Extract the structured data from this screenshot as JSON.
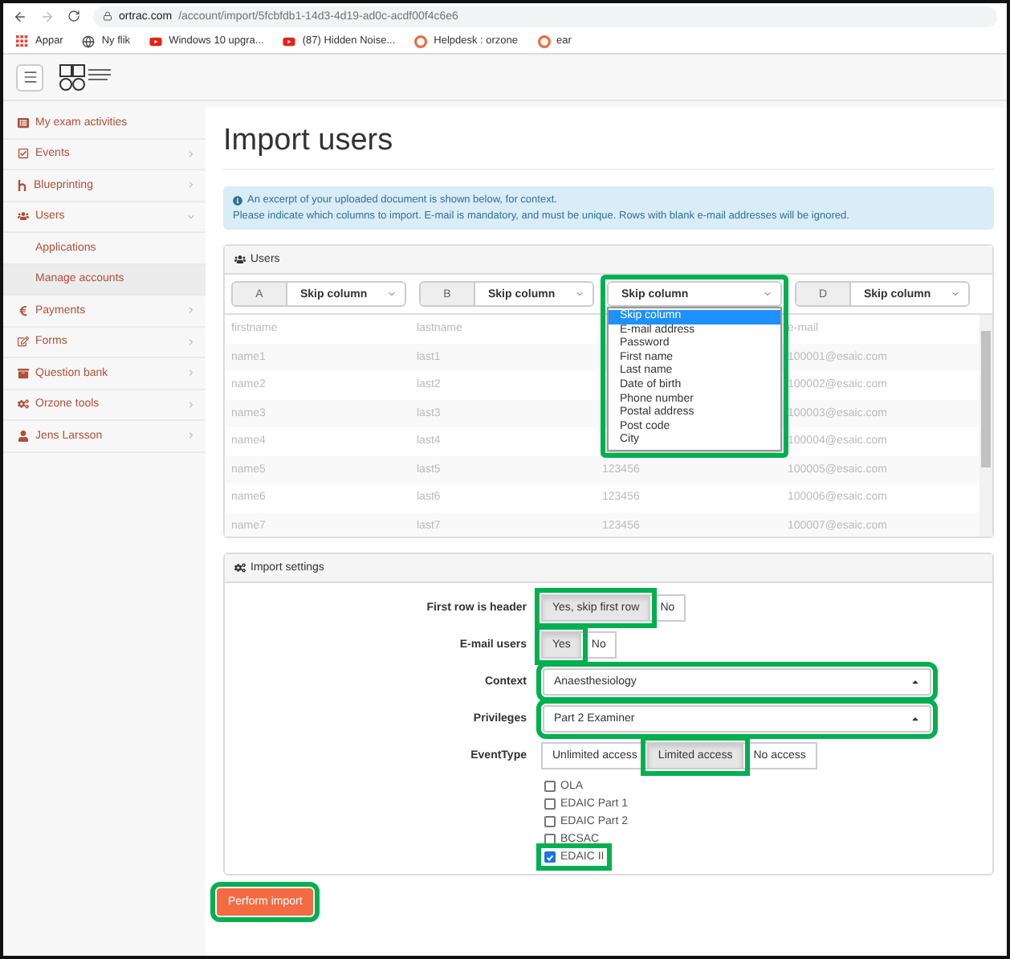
{
  "browser": {
    "host": "ortrac.com",
    "path": "/account/import/5fcbfdb1-14d3-4d19-ad0c-acdf00f4c6e6",
    "bookmarks": [
      {
        "label": "Appar",
        "kind": "apps"
      },
      {
        "label": "Ny flik",
        "kind": "globe"
      },
      {
        "label": "Windows 10 upgra...",
        "kind": "video"
      },
      {
        "label": "(87) Hidden Noise...",
        "kind": "video"
      },
      {
        "label": "Helpdesk : orzone",
        "kind": "help"
      },
      {
        "label": "ear",
        "kind": "help"
      }
    ]
  },
  "sidebar": {
    "items": [
      {
        "label": "My exam activities",
        "kind": "link"
      },
      {
        "label": "Events",
        "kind": "group",
        "expanded": false
      },
      {
        "label": "Blueprinting",
        "kind": "group",
        "expanded": false
      },
      {
        "label": "Users",
        "kind": "group",
        "expanded": true,
        "children": [
          {
            "label": "Applications",
            "selected": false
          },
          {
            "label": "Manage accounts",
            "selected": true
          }
        ]
      },
      {
        "label": "Payments",
        "kind": "group",
        "expanded": false
      },
      {
        "label": "Forms",
        "kind": "group",
        "expanded": false
      },
      {
        "label": "Question bank",
        "kind": "group",
        "expanded": false
      },
      {
        "label": "Orzone tools",
        "kind": "group",
        "expanded": false
      },
      {
        "label": "Jens Larsson",
        "kind": "group",
        "expanded": false
      }
    ]
  },
  "page": {
    "title": "Import users",
    "info": [
      "An excerpt of your uploaded document is shown below, for context.",
      "Please indicate which columns to import. E-mail is mandatory, and must be unique. Rows with blank e-mail addresses will be ignored."
    ]
  },
  "users_panel": {
    "title": "Users",
    "columns": [
      {
        "letter": "A",
        "value": "Skip column",
        "open": false,
        "highlighted": false
      },
      {
        "letter": "B",
        "value": "Skip column",
        "open": false,
        "highlighted": false
      },
      {
        "value": "Skip column",
        "open": true,
        "highlighted": true,
        "options": [
          {
            "label": "Skip column",
            "selected": true
          },
          {
            "label": "E-mail address",
            "selected": false
          },
          {
            "label": "Password",
            "selected": false
          },
          {
            "label": "First name",
            "selected": false
          },
          {
            "label": "Last name",
            "selected": false
          },
          {
            "label": "Date of birth",
            "selected": false
          },
          {
            "label": "Phone number",
            "selected": false
          },
          {
            "label": "Postal address",
            "selected": false
          },
          {
            "label": "Post code",
            "selected": false
          },
          {
            "label": "City",
            "selected": false
          }
        ]
      },
      {
        "letter": "D",
        "value": "Skip column",
        "open": false,
        "highlighted": false
      }
    ],
    "rows": [
      {
        "a": "firstname",
        "b": "lastname",
        "d": "e-mail"
      },
      {
        "a": "name1",
        "b": "last1",
        "d": "100001@esaic.com"
      },
      {
        "a": "name2",
        "b": "last2",
        "d": "100002@esaic.com"
      },
      {
        "a": "name3",
        "b": "last3",
        "d": "100003@esaic.com"
      },
      {
        "a": "name4",
        "b": "last4",
        "d": "100004@esaic.com"
      },
      {
        "a": "name5",
        "b": "last5",
        "c": "123456",
        "d": "100005@esaic.com"
      },
      {
        "a": "name6",
        "b": "last6",
        "c": "123456",
        "d": "100006@esaic.com"
      },
      {
        "a": "name7",
        "b": "last7",
        "c": "123456",
        "d": "100007@esaic.com"
      }
    ]
  },
  "settings_panel": {
    "title": "Import settings",
    "fields": [
      {
        "kind": "toggle",
        "label": "First row is header",
        "options": [
          {
            "label": "Yes, skip first row",
            "selected": true,
            "highlighted": true
          },
          {
            "label": "No",
            "selected": false,
            "highlighted": false
          }
        ]
      },
      {
        "kind": "toggle",
        "label": "E-mail users",
        "options": [
          {
            "label": "Yes",
            "selected": true,
            "highlighted": true
          },
          {
            "label": "No",
            "selected": false,
            "highlighted": false
          }
        ]
      },
      {
        "kind": "select",
        "label": "Context",
        "value": "Anaesthesiology",
        "highlighted": true
      },
      {
        "kind": "select",
        "label": "Privileges",
        "value": "Part 2 Examiner",
        "highlighted": true
      },
      {
        "kind": "toggle",
        "label": "EventType",
        "options": [
          {
            "label": "Unlimited access",
            "selected": false,
            "highlighted": false
          },
          {
            "label": "Limited access",
            "selected": true,
            "highlighted": true
          },
          {
            "label": "No access",
            "selected": false,
            "highlighted": false
          }
        ]
      },
      {
        "kind": "checks",
        "items": [
          {
            "label": "OLA",
            "checked": false,
            "highlighted": false
          },
          {
            "label": "EDAIC Part 1",
            "checked": false,
            "highlighted": false
          },
          {
            "label": "EDAIC Part 2",
            "checked": false,
            "highlighted": false
          },
          {
            "label": "BCSAC",
            "checked": false,
            "highlighted": false
          },
          {
            "label": "EDAIC II",
            "checked": true,
            "highlighted": true
          }
        ]
      }
    ]
  },
  "submit": {
    "label": "Perform import",
    "highlighted": true
  }
}
